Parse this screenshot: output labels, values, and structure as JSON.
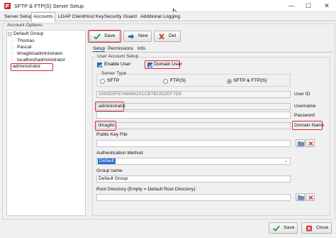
{
  "window": {
    "title": "SFTP & FTP(S) Server Setup",
    "minimize_glyph": "—",
    "maximize_glyph": "☐",
    "close_glyph": "✕"
  },
  "main_tabs": [
    "Server Setup",
    "Accounts",
    "LDAP Client",
    "Host Key",
    "Security",
    "Guard",
    "Additional",
    "Logging"
  ],
  "account_options": {
    "label": "Account Options",
    "tree": {
      "root": "Default Group",
      "children": [
        "Thomas",
        "Pascal",
        "limagito\\administrator",
        "localhost\\administrator",
        "administrator"
      ],
      "selected": "administrator"
    }
  },
  "toolbar": {
    "save_label": "Save",
    "new_label": "New",
    "del_label": "Del"
  },
  "sub_tabs": [
    "Setup",
    "Permissions",
    "Info"
  ],
  "user_account_setup": {
    "label": "User Account Setup",
    "enable_user_label": "Enable User",
    "domain_user_label": "Domain User",
    "server_type": {
      "label": "Server Type",
      "options": [
        "SFTP",
        "FTP(S)",
        "SFTP & FTP(S)"
      ],
      "selected": "SFTP & FTP(S)"
    },
    "user_id": {
      "value": "2563D5F67464942A1CB7B1552EF7D8",
      "label": "User ID"
    },
    "username": {
      "value": "administrator",
      "label": "Username"
    },
    "password": {
      "value": "",
      "label": "Password"
    },
    "domain_name": {
      "value": "limagito",
      "label": "Domain Name"
    },
    "public_key_file": {
      "label": "Public Key File",
      "value": ""
    },
    "authentication_method": {
      "label": "Authentication Method",
      "selected": "Default"
    },
    "group_name": {
      "label": "Group name",
      "value": "Default Group"
    },
    "root_directory": {
      "label": "Root Directory (Empty = Default Root Directory):",
      "value": ""
    }
  },
  "footer": {
    "save_label": "Save",
    "close_label": "Close"
  },
  "colors": {
    "highlight": "#d9262d",
    "accent": "#2a6fcf",
    "save_green": "#2e9b3a",
    "new_blue": "#2f6db5",
    "del_red": "#d33a2c"
  }
}
